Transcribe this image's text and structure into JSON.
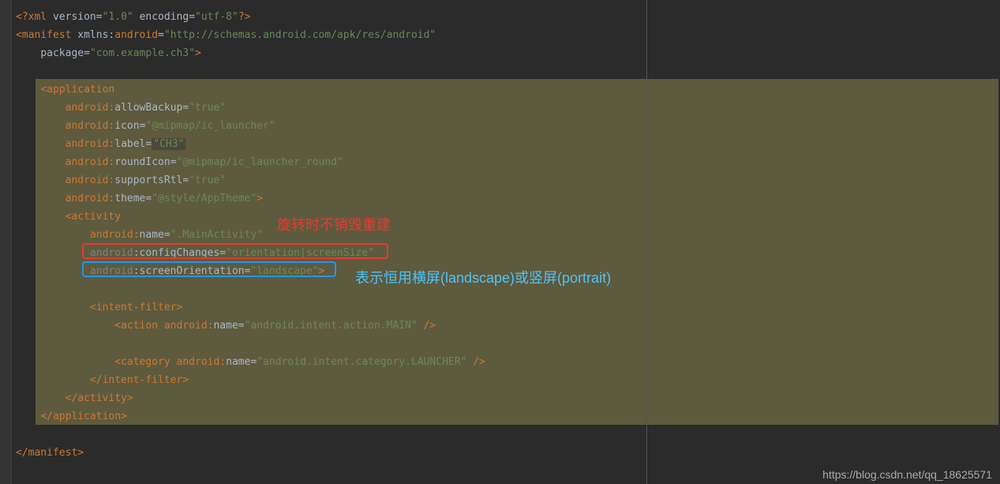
{
  "xml": {
    "declaration_xml": "?xml",
    "version_attr": "version",
    "version_val": "\"1.0\"",
    "encoding_attr": "encoding",
    "encoding_val": "\"utf-8\"",
    "decl_close": "?>"
  },
  "manifest": {
    "open": "manifest",
    "xmlns_prefix": "xmlns:",
    "xmlns_android": "android",
    "xmlns_val": "\"http://schemas.android.com/apk/res/android\"",
    "package_attr": "package",
    "package_val": "\"com.example.ch3\"",
    "close": "/manifest"
  },
  "application": {
    "open": "application",
    "allowBackup_ns": "android:",
    "allowBackup_attr": "allowBackup",
    "allowBackup_val": "\"true\"",
    "icon_ns": "android:",
    "icon_attr": "icon",
    "icon_val": "\"@mipmap/ic_launcher\"",
    "label_ns": "android:",
    "label_attr": "label",
    "label_val": "\"CH3\"",
    "roundIcon_ns": "android:",
    "roundIcon_attr": "roundIcon",
    "roundIcon_val": "\"@mipmap/ic_launcher_round\"",
    "supportsRtl_ns": "android:",
    "supportsRtl_attr": "supportsRtl",
    "supportsRtl_val": "\"true\"",
    "theme_ns": "android:",
    "theme_attr": "theme",
    "theme_val": "\"@style/AppTheme\"",
    "close": "/application"
  },
  "activity": {
    "open": "activity",
    "name_ns": "android:",
    "name_attr": "name",
    "name_val": "\".MainActivity\"",
    "configChanges_ns": "android",
    "configChanges_attr": ":configChanges",
    "configChanges_val": "\"orientation|screenSize\"",
    "screenOrientation_ns": "android",
    "screenOrientation_attr": ":screenOrientation",
    "screenOrientation_val": "\"landscape\"",
    "close": "/activity"
  },
  "intentFilter": {
    "open": "intent-filter",
    "action": "action",
    "action_ns": "android:",
    "action_name_attr": "name",
    "action_name_val": "\"android.intent.action.MAIN\"",
    "category": "category",
    "category_ns": "android:",
    "category_name_attr": "name",
    "category_name_val": "\"android.intent.category.LAUNCHER\"",
    "close": "/intent-filter"
  },
  "annotations": {
    "red_text": "旋转时不销毁重建",
    "blue_text": "表示恒用横屏(landscape)或竖屏(portrait)"
  },
  "watermark": "https://blog.csdn.net/qq_18625571"
}
